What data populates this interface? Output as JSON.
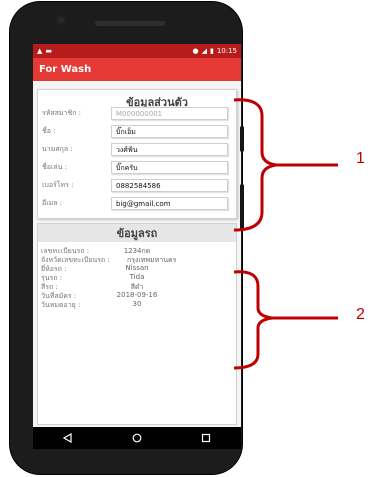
{
  "status_bar": {
    "time": "10:15"
  },
  "app_bar": {
    "title": "For Wash"
  },
  "personal": {
    "title": "ข้อมูลส่วนตัว",
    "fields": [
      {
        "label": "รหัสสมาชิก :",
        "value": "M000000001",
        "placeholder": true
      },
      {
        "label": "ชื่อ :",
        "value": "บิ๊กเอ็ม"
      },
      {
        "label": "นามสกุล :",
        "value": "วงศ์ฟ้น"
      },
      {
        "label": "ชื่อเล่น :",
        "value": "บิ๊กครับ"
      },
      {
        "label": "เบอร์โทร :",
        "value": "0882584586"
      },
      {
        "label": "อีเมล :",
        "value": "big@gmail.com"
      }
    ]
  },
  "car": {
    "title": "ข้อมูลรถ",
    "rows": [
      {
        "key": "เลขทะเบียนรถ :",
        "value": "1234กด"
      },
      {
        "key": "จังหวัดเลขทะเบียนรถ :",
        "value": "กรุงเทพมหานคร"
      },
      {
        "key": "ยี่ห้อรถ :",
        "value": "Nissan"
      },
      {
        "key": "รุ่นรถ :",
        "value": "Tida"
      },
      {
        "key": "สีรถ :",
        "value": "สีดำ"
      },
      {
        "key": "วันที่สมัคร :",
        "value": "2018-09-16"
      },
      {
        "key": "วันหมดอายุ :",
        "value": "30"
      }
    ]
  },
  "annotations": {
    "one": "1",
    "two": "2"
  },
  "colors": {
    "status": "#b71c1c",
    "appbar": "#e53935",
    "bracket": "#c00000"
  }
}
